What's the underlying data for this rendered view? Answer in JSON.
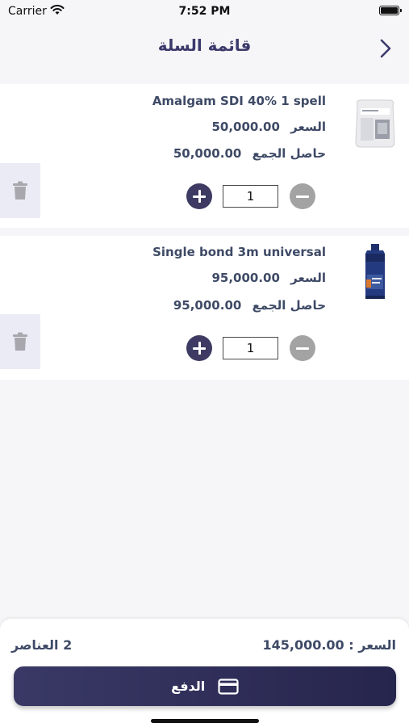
{
  "status_bar": {
    "carrier": "Carrier",
    "time": "7:52 PM"
  },
  "nav": {
    "title": "قائمة السلة",
    "back_icon": "chevron-right-icon"
  },
  "items": [
    {
      "name": "Amalgam SDI 40% 1 spell",
      "price_label": "السعر",
      "price": "50,000.00",
      "total_label": "حاصل الجمع",
      "total": "50,000.00",
      "quantity": "1",
      "image": "amalgam-package-image"
    },
    {
      "name": "Single bond 3m universal",
      "price_label": "السعر",
      "price": "95,000.00",
      "total_label": "حاصل الجمع",
      "total": "95,000.00",
      "quantity": "1",
      "image": "bond-bottle-image"
    }
  ],
  "footer": {
    "price_label": "السعر :",
    "total": "145,000.00",
    "count": "2",
    "count_label": "العناصر",
    "pay_label": "الدفع",
    "pay_icon": "credit-card-icon"
  },
  "colors": {
    "accent": "#3d3b63",
    "text": "#3e4a66",
    "delete_bg": "#ebebf6",
    "minus": "#a3a3a3"
  }
}
